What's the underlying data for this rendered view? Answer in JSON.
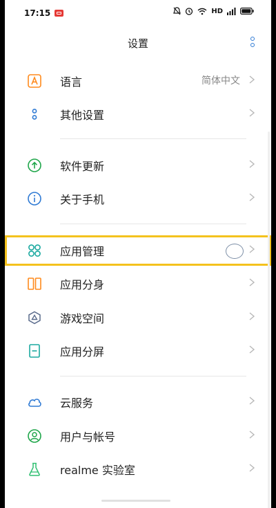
{
  "status_bar": {
    "time": "17:15",
    "network": "HD",
    "icons": [
      "notification-app-icon",
      "alarm-off-icon",
      "alarm-icon",
      "wifi-icon",
      "signal-icon",
      "battery-icon"
    ]
  },
  "header": {
    "title": "设置",
    "menu_icon": "more-vertical-icon"
  },
  "settings": [
    {
      "id": "language",
      "label": "语言",
      "value": "简体中文",
      "icon": "language-icon"
    },
    {
      "id": "other",
      "label": "其他设置",
      "value": "",
      "icon": "other-settings-icon"
    },
    {
      "id": "update",
      "label": "软件更新",
      "value": "",
      "icon": "update-icon"
    },
    {
      "id": "about",
      "label": "关于手机",
      "value": "",
      "icon": "info-icon"
    },
    {
      "id": "app-management",
      "label": "应用管理",
      "value": "",
      "icon": "app-management-icon",
      "highlighted": true
    },
    {
      "id": "app-clone",
      "label": "应用分身",
      "value": "",
      "icon": "app-clone-icon"
    },
    {
      "id": "game-space",
      "label": "游戏空间",
      "value": "",
      "icon": "game-space-icon"
    },
    {
      "id": "split-screen",
      "label": "应用分屏",
      "value": "",
      "icon": "split-screen-icon"
    },
    {
      "id": "cloud",
      "label": "云服务",
      "value": "",
      "icon": "cloud-icon"
    },
    {
      "id": "account",
      "label": "用户与帐号",
      "value": "",
      "icon": "user-account-icon"
    },
    {
      "id": "realme-lab",
      "label": "realme 实验室",
      "value": "",
      "icon": "lab-flask-icon"
    }
  ],
  "colors": {
    "highlight_border": "#f4c21d",
    "accent_blue": "#2f7ad4",
    "teal": "#1ba9a0",
    "orange": "#ff8a1c"
  }
}
